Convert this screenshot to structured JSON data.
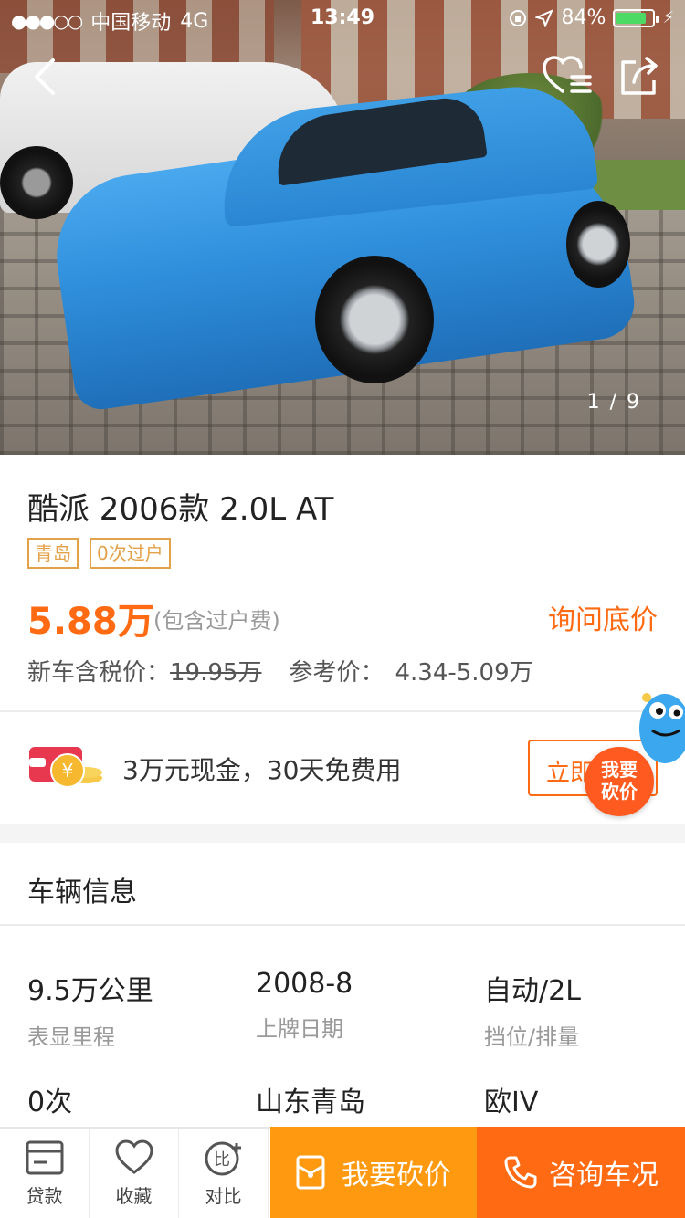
{
  "status_bar": {
    "carrier": "中国移动",
    "network": "4G",
    "time": "13:49",
    "battery": "84%",
    "battery_level": 0.84
  },
  "gallery": {
    "counter": "1 / 9"
  },
  "car": {
    "title": "酷派 2006款 2.0L AT",
    "tags": [
      "青岛",
      "0次过户"
    ],
    "price": "5.88万",
    "price_note": "(包含过户费)",
    "ask_price_label": "询问底价",
    "new_price_label": "新车含税价：",
    "new_price": "19.95万",
    "ref_price_label": "参考价：",
    "ref_price": "4.34-5.09万"
  },
  "loan": {
    "text": "3万元现金，30天免费用",
    "button": "立即",
    "bargain_badge_line1": "我要",
    "bargain_badge_line2": "砍价"
  },
  "vehicle_info": {
    "title": "车辆信息",
    "specs": [
      {
        "value": "9.5万公里",
        "label": "表显里程"
      },
      {
        "value": "2008-8",
        "label": "上牌日期"
      },
      {
        "value": "自动/2L",
        "label": "挡位/排量"
      },
      {
        "value": "0次",
        "label": ""
      },
      {
        "value": "山东青岛",
        "label": ""
      },
      {
        "value": "欧IV",
        "label": ""
      }
    ]
  },
  "bottom_bar": {
    "loan": "贷款",
    "favorite": "收藏",
    "compare": "对比",
    "bargain": "我要砍价",
    "consult": "咨询车况"
  },
  "colors": {
    "accent": "#ff6a13",
    "bargain": "#ff9a10",
    "tag": "#e3a24a"
  }
}
